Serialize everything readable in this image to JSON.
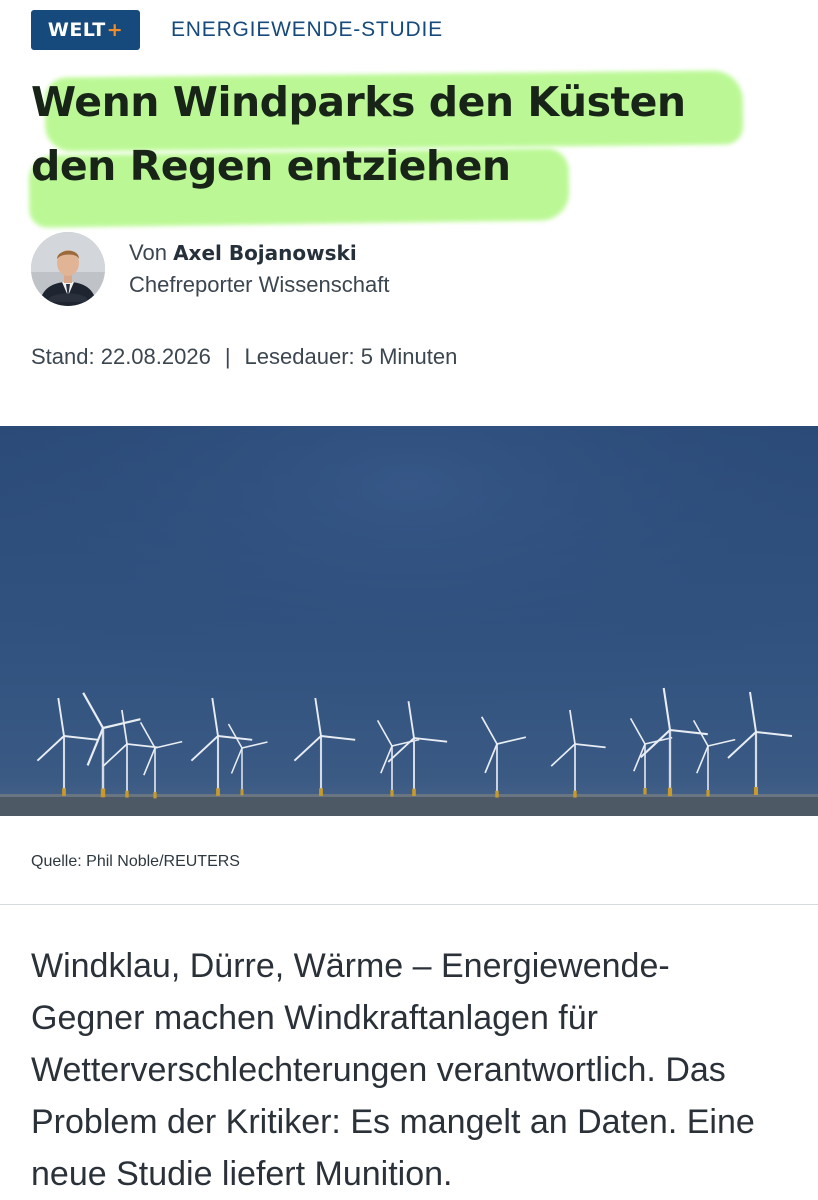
{
  "header": {
    "logo_text": "WELT",
    "logo_plus": "+",
    "kicker": "ENERGIEWENDE-STUDIE"
  },
  "article": {
    "headline_line1": "Wenn Windparks den Küsten",
    "headline_line2": "den Regen entziehen",
    "author": {
      "prefix": "Von",
      "name": "Axel Bojanowski",
      "role": "Chefreporter Wissenschaft"
    },
    "stand": "Stand: 22.08.2026",
    "separator": "|",
    "reading_time": "Lesedauer: 5 Minuten",
    "image_caption": "Quelle: Phil Noble/REUTERS",
    "teaser": "Windklau, Dürre, Wärme – Energiewende-Gegner machen Windkraftanlagen für Wetterverschlechterungen verantwortlich. Das Problem der Kritiker: Es mangelt an Daten. Eine neue Studie liefert Munition."
  },
  "colors": {
    "brand": "#174a7c",
    "brand_plus": "#f28c28",
    "highlight": "#b8f890"
  }
}
